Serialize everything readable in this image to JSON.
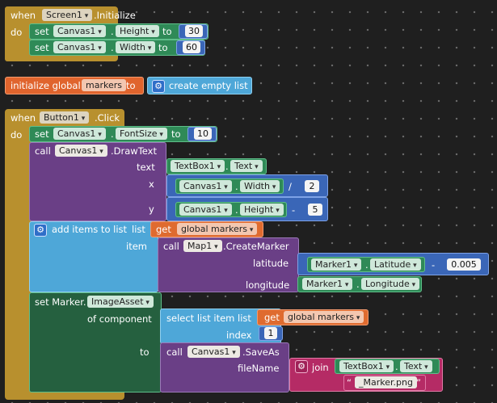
{
  "blocks": {
    "screen_init": {
      "when": "when",
      "component": "Screen1",
      "event": ".Initialize",
      "do": "do",
      "set1": {
        "set": "set",
        "component": "Canvas1",
        "dot": ".",
        "prop": "Height",
        "to": "to",
        "value": "30"
      },
      "set2": {
        "set": "set",
        "component": "Canvas1",
        "dot": ".",
        "prop": "Width",
        "to": "to",
        "value": "60"
      }
    },
    "global_init": {
      "label": "initialize global",
      "name": "markers",
      "to": "to",
      "value_label": "create empty list"
    },
    "button_click": {
      "when": "when",
      "component": "Button1",
      "event": ".Click",
      "do": "do",
      "set_font": {
        "set": "set",
        "component": "Canvas1",
        "dot": ".",
        "prop": "FontSize",
        "to": "to",
        "value": "10"
      },
      "draw_text": {
        "call": "call",
        "component": "Canvas1",
        "method": ".DrawText",
        "text_label": "text",
        "text_comp": "TextBox1",
        "text_dot": ".",
        "text_prop": "Text",
        "x_label": "x",
        "x_comp": "Canvas1",
        "x_dot": ".",
        "x_prop": "Width",
        "x_op": "/",
        "x_val": "2",
        "y_label": "y",
        "y_comp": "Canvas1",
        "y_dot": ".",
        "y_prop": "Height",
        "y_op": "-",
        "y_val": "5"
      },
      "add_items": {
        "label": "add items to list",
        "list_label": "list",
        "get": "get",
        "get_var": "global markers",
        "item_label": "item",
        "call": "call",
        "component": "Map1",
        "method": ".CreateMarker",
        "lat_label": "latitude",
        "lat_comp": "Marker1",
        "lat_dot": ".",
        "lat_prop": "Latitude",
        "lat_op": "-",
        "lat_val": "0.005",
        "lon_label": "longitude",
        "lon_comp": "Marker1",
        "lon_dot": ".",
        "lon_prop": "Longitude"
      },
      "set_marker": {
        "label": "set Marker.",
        "prop": "ImageAsset",
        "of_component": "of component",
        "select_label": "select list item",
        "list_label": "list",
        "get": "get",
        "get_var": "global markers",
        "index_label": "index",
        "index_val": "1",
        "to": "to",
        "call": "call",
        "component": "Canvas1",
        "method": ".SaveAs",
        "filename_label": "fileName",
        "join": "join",
        "join_comp": "TextBox1",
        "join_dot": ".",
        "join_prop": "Text",
        "str_open": "“",
        "str_val": "_Marker.png",
        "str_close": "”"
      }
    }
  }
}
